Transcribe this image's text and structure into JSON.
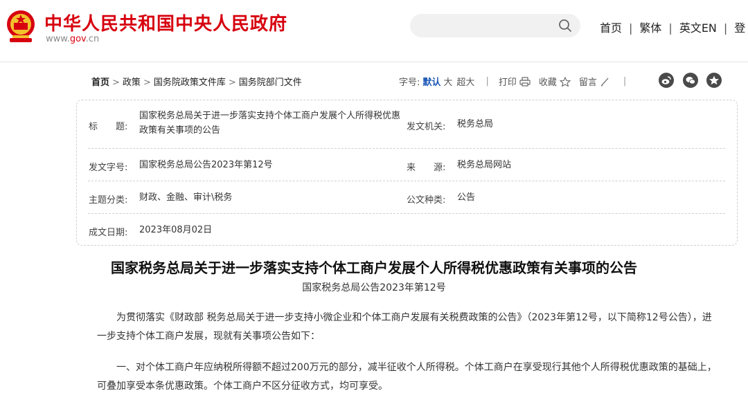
{
  "header": {
    "site_title": "中华人民共和国中央人民政府",
    "domain_prefix": "www.",
    "domain_gov": "gov",
    "domain_suffix": ".cn",
    "nav": [
      "首页",
      "繁体",
      "英文EN",
      "登"
    ]
  },
  "breadcrumb": [
    "首页",
    "政策",
    "国务院政策文件库",
    "国务院部门文件"
  ],
  "toolbar": {
    "font_label": "字号:",
    "font_default": "默认",
    "font_large": "大",
    "font_xlarge": "超大",
    "print": "打印",
    "favorite": "收藏",
    "comment": "留言"
  },
  "meta": {
    "title_label": "标　　题:",
    "title_value": "国家税务总局关于进一步落实支持个体工商户发展个人所得税优惠政策有关事项的公告",
    "issuer_label": "发文机关:",
    "issuer_value": "税务总局",
    "docno_label": "发文字号:",
    "docno_value": "国家税务总局公告2023年第12号",
    "source_label": "来　　源:",
    "source_value": "税务总局网站",
    "topic_label": "主题分类:",
    "topic_value": "财政、金融、审计\\税务",
    "type_label": "公文种类:",
    "type_value": "公告",
    "date_label": "成文日期:",
    "date_value": "2023年08月02日"
  },
  "article": {
    "title": "国家税务总局关于进一步落实支持个体工商户发展个人所得税优惠政策有关事项的公告",
    "subtitle": "国家税务总局公告2023年第12号",
    "para1": "为贯彻落实《财政部 税务总局关于进一步支持小微企业和个体工商户发展有关税费政策的公告》（2023年第12号，以下简称12号公告），进一步支持个体工商户发展，现就有关事项公告如下：",
    "para2": "一、对个体工商户年应纳税所得额不超过200万元的部分，减半征收个人所得税。个体工商户在享受现行其他个人所得税优惠政策的基础上，可叠加享受本条优惠政策。个体工商户不区分征收方式，均可享受。"
  },
  "colors": {
    "brand_red": "#d7000f",
    "link_blue": "#1a56b4"
  }
}
